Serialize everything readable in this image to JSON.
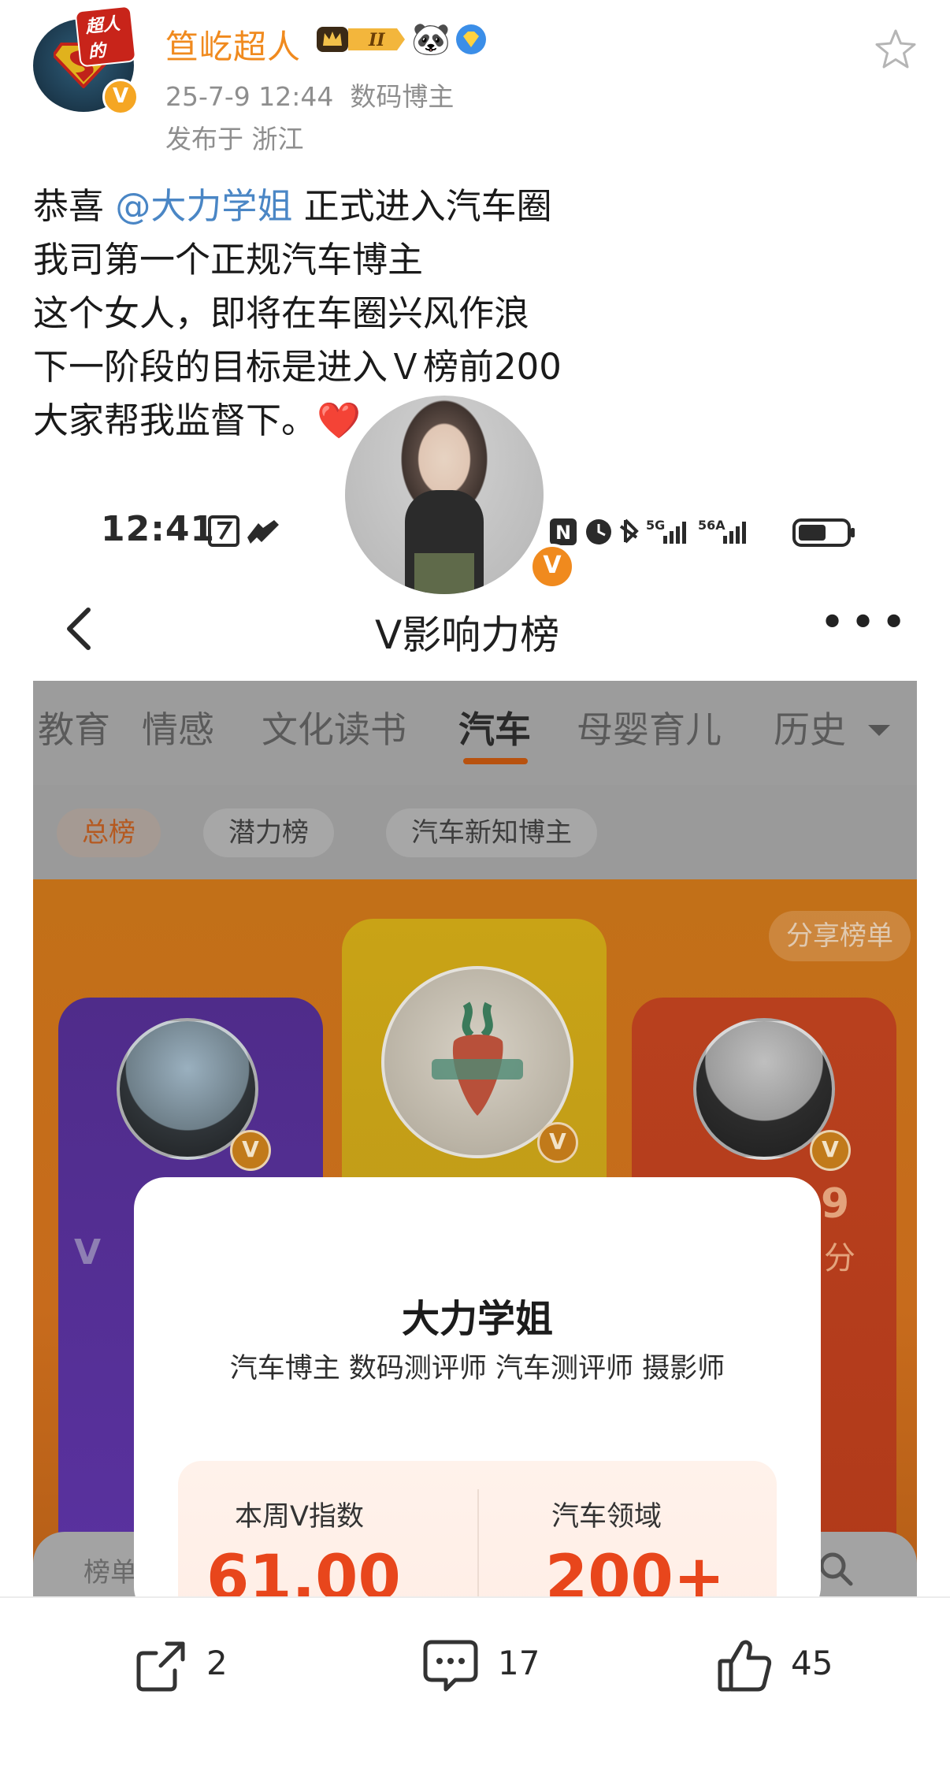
{
  "author": {
    "name": "笪屹超人",
    "avatar_badge_text": "超人的",
    "time": "25-7-9 12:44",
    "role": "数码博主",
    "location": "发布于 浙江"
  },
  "post": {
    "line1_prefix": "恭喜 ",
    "mention": "@大力学姐",
    "line1_suffix": " 正式进入汽车圈",
    "line2": "我司第一个正规汽车博主",
    "line3": "这个女人，即将在车圈兴风作浪",
    "line4": "下一阶段的目标是进入Ｖ榜前200",
    "line5": "大家帮我监督下。",
    "emoji": "❤️"
  },
  "screenshot": {
    "status_time": "12:41",
    "nav_title": "V影响力榜",
    "tabs": [
      "教育",
      "情感",
      "文化读书",
      "汽车",
      "母婴育儿",
      "历史"
    ],
    "active_tab": "汽车",
    "subtabs": [
      "总榜",
      "潜力榜",
      "汽车新知博主"
    ],
    "active_subtab": "总榜",
    "share_button": "分享榜单",
    "right_card_rank_fragment": "9",
    "right_card_score_fragment": "分",
    "left_card_fragment": "V",
    "bottom_strip_label": "榜单",
    "popup": {
      "name": "大力学姐",
      "tags": "汽车博主 数码测评师 汽车测评师 摄影师",
      "stat1_label": "本周V指数",
      "stat1_value": "61.00",
      "stat2_label": "汽车领域",
      "stat2_value": "200+"
    }
  },
  "actions": {
    "share_count": "2",
    "comment_count": "17",
    "like_count": "45"
  },
  "colors": {
    "username": "#f08a1e",
    "mention": "#4a86c5",
    "meta_gray": "#8e8e8e",
    "accent_orange": "#e8461c"
  }
}
